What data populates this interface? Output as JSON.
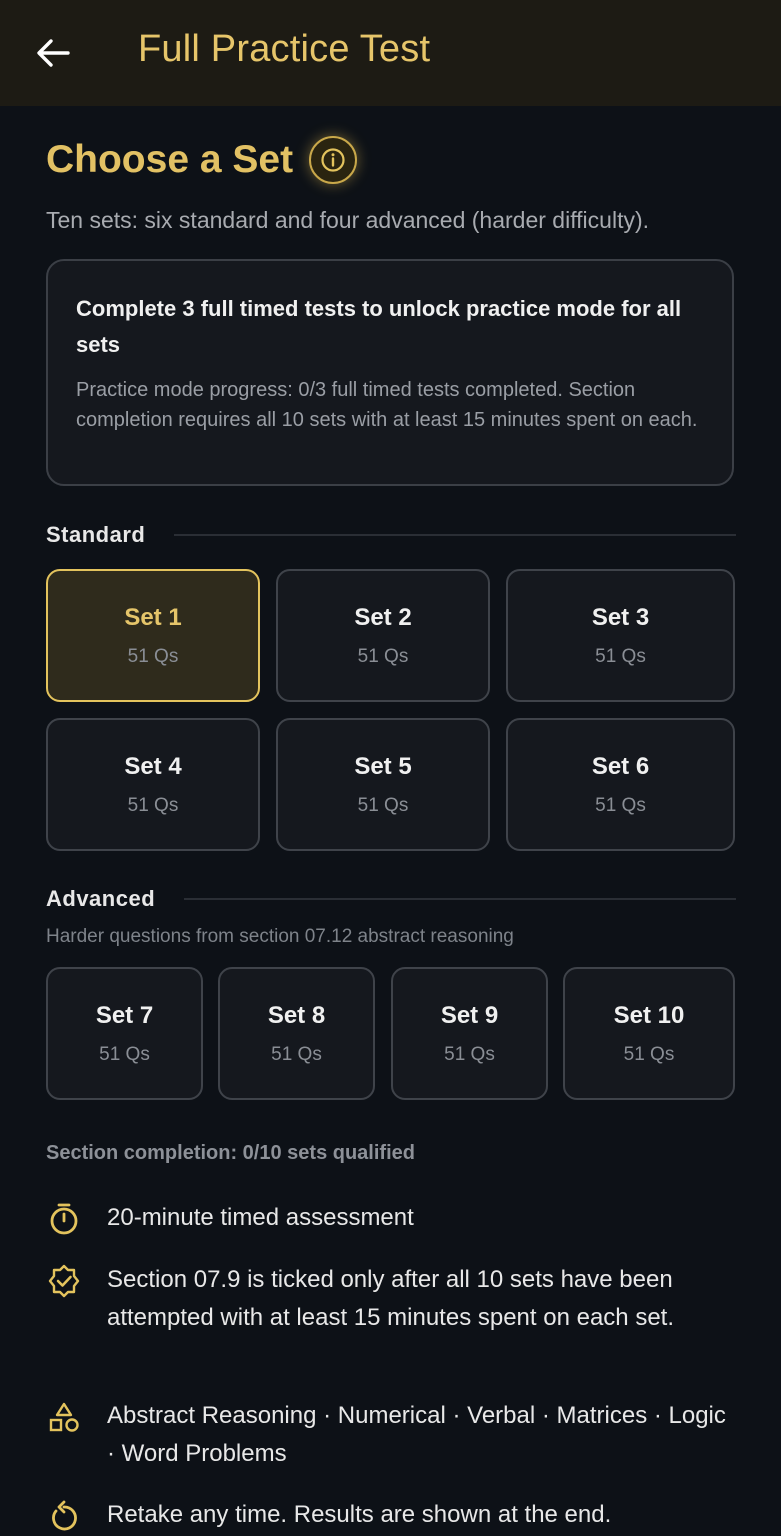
{
  "appbar": {
    "title": "Full Practice Test",
    "back_icon": "arrow-left-icon"
  },
  "header": {
    "title": "Choose a Set",
    "info_icon": "info-icon",
    "subtitle": "Ten sets: six standard and four advanced (harder difficulty)."
  },
  "notice": {
    "title": "Complete 3 full timed tests to unlock practice mode for all sets",
    "body": "Practice mode progress: 0/3 full timed tests completed. Section completion requires all 10 sets with at least 15 minutes spent on each."
  },
  "standard": {
    "label": "Standard",
    "sets": [
      {
        "name": "Set 1",
        "qs": "51 Qs",
        "selected": true
      },
      {
        "name": "Set 2",
        "qs": "51 Qs"
      },
      {
        "name": "Set 3",
        "qs": "51 Qs"
      },
      {
        "name": "Set 4",
        "qs": "51 Qs"
      },
      {
        "name": "Set 5",
        "qs": "51 Qs"
      },
      {
        "name": "Set 6",
        "qs": "51 Qs"
      }
    ]
  },
  "advanced": {
    "label": "Advanced",
    "note": "Harder questions from section 07.12 abstract reasoning",
    "sets": [
      {
        "name": "Set 7",
        "qs": "51 Qs"
      },
      {
        "name": "Set 8",
        "qs": "51 Qs"
      },
      {
        "name": "Set 9",
        "qs": "51 Qs"
      },
      {
        "name": "Set 10",
        "qs": "51 Qs"
      }
    ]
  },
  "completion": "Section completion: 0/10 sets qualified",
  "features": [
    {
      "icon": "timer-icon",
      "text": "20-minute timed assessment"
    },
    {
      "icon": "verified-badge-icon",
      "text": "Section 07.9 is ticked only after all 10 sets have been attempted with at least 15 minutes spent on each set."
    },
    {
      "icon": "shapes-icon",
      "text": "Abstract Reasoning · Numerical · Verbal · Matrices · Logic · Word Problems"
    },
    {
      "icon": "replay-icon",
      "text": "Retake any time. Results are shown at the end."
    }
  ],
  "colors": {
    "accent": "#e3c35d",
    "background": "#0d1117",
    "appbar": "#1d1b14"
  }
}
